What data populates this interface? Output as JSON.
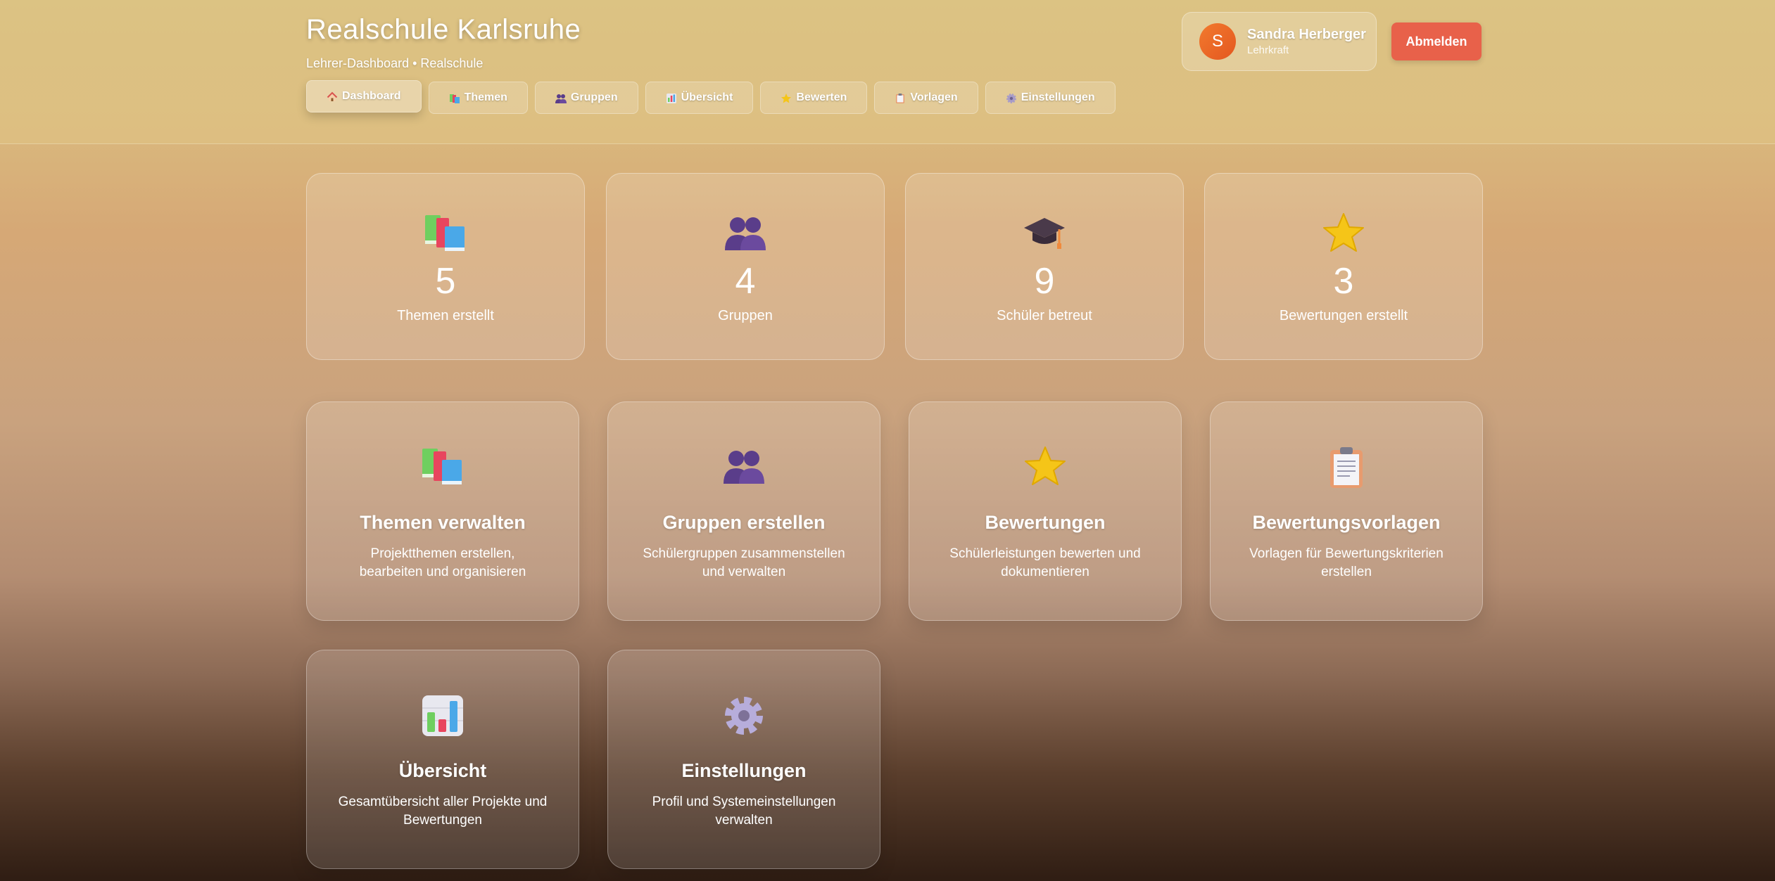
{
  "header": {
    "title": "Realschule Karlsruhe",
    "subtitle": "Lehrer-Dashboard • Realschule"
  },
  "nav": [
    {
      "label": "Dashboard",
      "icon": "house-icon",
      "active": true
    },
    {
      "label": "Themen",
      "icon": "books-icon"
    },
    {
      "label": "Gruppen",
      "icon": "people-icon"
    },
    {
      "label": "Übersicht",
      "icon": "bar-chart-icon"
    },
    {
      "label": "Bewerten",
      "icon": "star-icon"
    },
    {
      "label": "Vorlagen",
      "icon": "clipboard-icon"
    },
    {
      "label": "Einstellungen",
      "icon": "gear-icon"
    }
  ],
  "user": {
    "initial": "S",
    "name": "Sandra Herberger",
    "role": "Lehrkraft"
  },
  "logout_label": "Abmelden",
  "stats": [
    {
      "icon": "books-icon",
      "value": "5",
      "label": "Themen erstellt"
    },
    {
      "icon": "people-icon",
      "value": "4",
      "label": "Gruppen"
    },
    {
      "icon": "graduation-cap-icon",
      "value": "9",
      "label": "Schüler betreut"
    },
    {
      "icon": "star-icon",
      "value": "3",
      "label": "Bewertungen erstellt"
    }
  ],
  "cards": [
    {
      "icon": "books-icon",
      "title": "Themen verwalten",
      "desc": "Projektthemen erstellen, bearbeiten und organisieren"
    },
    {
      "icon": "people-icon",
      "title": "Gruppen erstellen",
      "desc": "Schülergruppen zusammenstellen und verwalten"
    },
    {
      "icon": "star-icon",
      "title": "Bewertungen",
      "desc": "Schülerleistungen bewerten und dokumentieren"
    },
    {
      "icon": "clipboard-icon",
      "title": "Bewertungsvorlagen",
      "desc": "Vorlagen für Bewertungskriterien erstellen"
    },
    {
      "icon": "bar-chart-icon",
      "title": "Übersicht",
      "desc": "Gesamtübersicht aller Projekte und Bewertungen"
    },
    {
      "icon": "gear-icon",
      "title": "Einstellungen",
      "desc": "Profil und Systemeinstellungen verwalten"
    }
  ],
  "colors": {
    "accent_logout": "#e8614a",
    "avatar": "#f27a2e"
  }
}
